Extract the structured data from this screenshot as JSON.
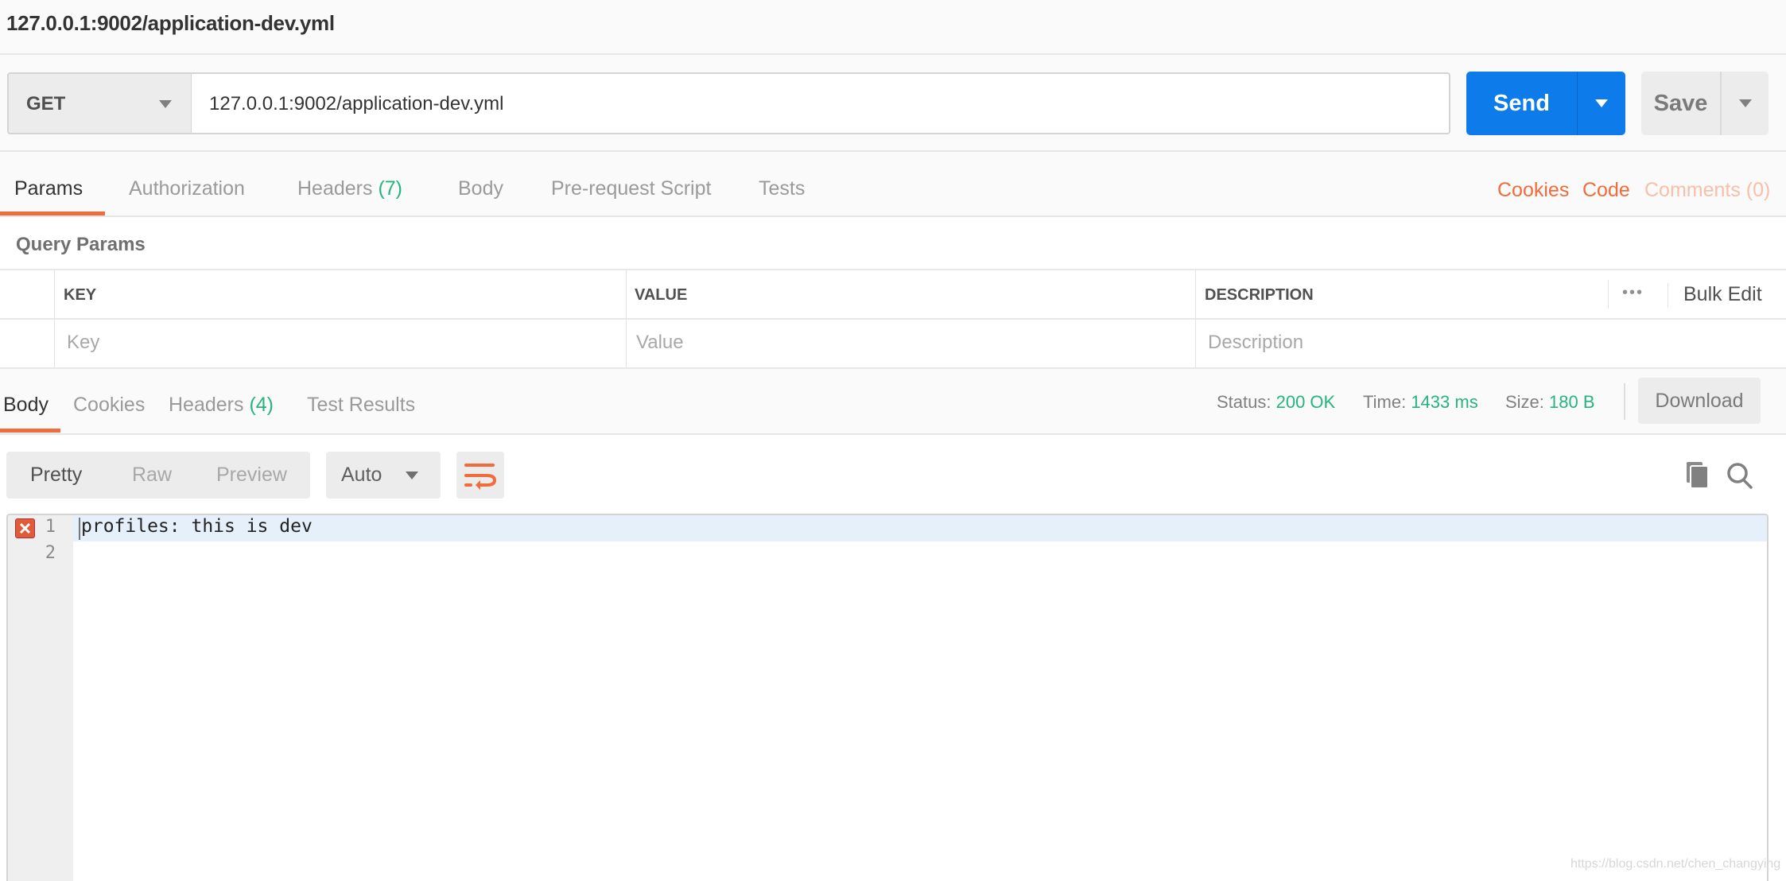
{
  "titlebar": {
    "title": "127.0.0.1:9002/application-dev.yml"
  },
  "request": {
    "method": "GET",
    "url": "127.0.0.1:9002/application-dev.yml",
    "send_label": "Send",
    "save_label": "Save"
  },
  "request_tabs": [
    {
      "label": "Params",
      "count": null,
      "active": true
    },
    {
      "label": "Authorization",
      "count": null
    },
    {
      "label": "Headers ",
      "count": "(7)"
    },
    {
      "label": "Body",
      "count": null
    },
    {
      "label": "Pre-request Script",
      "count": null
    },
    {
      "label": "Tests",
      "count": null
    }
  ],
  "request_links": {
    "cookies": "Cookies",
    "code": "Code",
    "comments": "Comments (0)"
  },
  "query_params": {
    "title": "Query Params",
    "columns": [
      "KEY",
      "VALUE",
      "DESCRIPTION"
    ],
    "placeholders": {
      "key": "Key",
      "value": "Value",
      "description": "Description"
    },
    "bulk_edit": "Bulk Edit",
    "more": "•••"
  },
  "response_tabs": [
    {
      "label": "Body",
      "active": true
    },
    {
      "label": "Cookies"
    },
    {
      "label": "Headers ",
      "count": "(4)"
    },
    {
      "label": "Test Results"
    }
  ],
  "response_meta": {
    "status_label": "Status:",
    "status": "200 OK",
    "time_label": "Time:",
    "time": "1433 ms",
    "size_label": "Size:",
    "size": "180 B",
    "download": "Download"
  },
  "body_toolbar": {
    "views": [
      "Pretty",
      "Raw",
      "Preview"
    ],
    "active_view": "Pretty",
    "format": "Auto"
  },
  "editor": {
    "lines": [
      {
        "number": "1",
        "text": "profiles: this is dev",
        "error": true
      },
      {
        "number": "2",
        "text": ""
      }
    ]
  },
  "watermark": "https://blog.csdn.net/chen_changying",
  "colors": {
    "accent": "#f26b3a",
    "send": "#0e7bea",
    "success": "#26b47f"
  }
}
